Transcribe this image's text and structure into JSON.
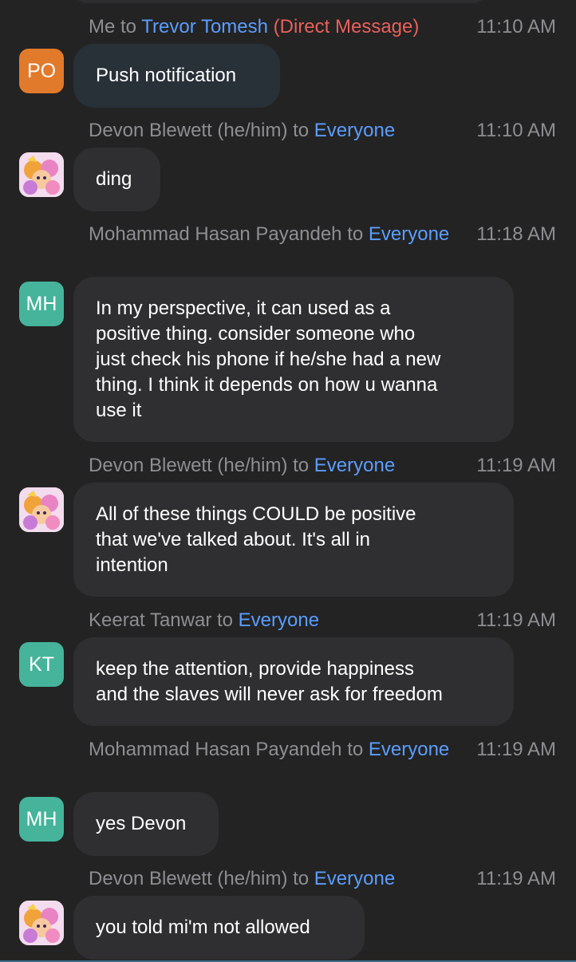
{
  "messages": [
    {
      "sender": "Me",
      "to_word": "to",
      "recipient": "Trevor Tomesh",
      "tag": "(Direct Message)",
      "time": "11:10 AM",
      "avatar": {
        "initials": "PO",
        "color": "#e27a2b"
      },
      "text": "Push notification"
    },
    {
      "sender": "Devon Blewett (he/him)",
      "to_word": "to",
      "recipient": "Everyone",
      "time": "11:10 AM",
      "avatar": {
        "image": "cartoon-avatar"
      },
      "text": "ding"
    },
    {
      "sender": "Mohammad Hasan Payandeh",
      "to_word": "to",
      "recipient": "Everyone",
      "time": "11:18 AM",
      "avatar": {
        "initials": "MH",
        "color": "#45b49a"
      },
      "text": "In my perspective, it can used as a\npositive thing. consider someone who\njust check his phone if he/she had a new\nthing. I think it depends on how u wanna\nuse it"
    },
    {
      "sender": "Devon Blewett (he/him)",
      "to_word": "to",
      "recipient": "Everyone",
      "time": "11:19 AM",
      "avatar": {
        "image": "cartoon-avatar"
      },
      "text": "All of these things COULD be positive\nthat we've talked about.  It's all in\nintention"
    },
    {
      "sender": "Keerat Tanwar",
      "to_word": "to",
      "recipient": "Everyone",
      "time": "11:19 AM",
      "avatar": {
        "initials": "KT",
        "color": "#45b49a"
      },
      "text": "keep the attention, provide happiness\nand the slaves will never ask for freedom"
    },
    {
      "sender": "Mohammad Hasan Payandeh",
      "to_word": "to",
      "recipient": "Everyone",
      "time": "11:19 AM",
      "avatar": {
        "initials": "MH",
        "color": "#45b49a"
      },
      "text": "yes Devon"
    },
    {
      "sender": "Devon Blewett (he/him)",
      "to_word": "to",
      "recipient": "Everyone",
      "time": "11:19 AM",
      "avatar": {
        "image": "cartoon-avatar"
      },
      "text": "you told mi'm not allowed"
    }
  ],
  "colors": {
    "background": "#232323",
    "bubble": "#2f2f31",
    "dm_bubble": "#283038",
    "recipient": "#5b9dfd",
    "direct_message": "#e9605a",
    "muted": "#8e8e93"
  }
}
